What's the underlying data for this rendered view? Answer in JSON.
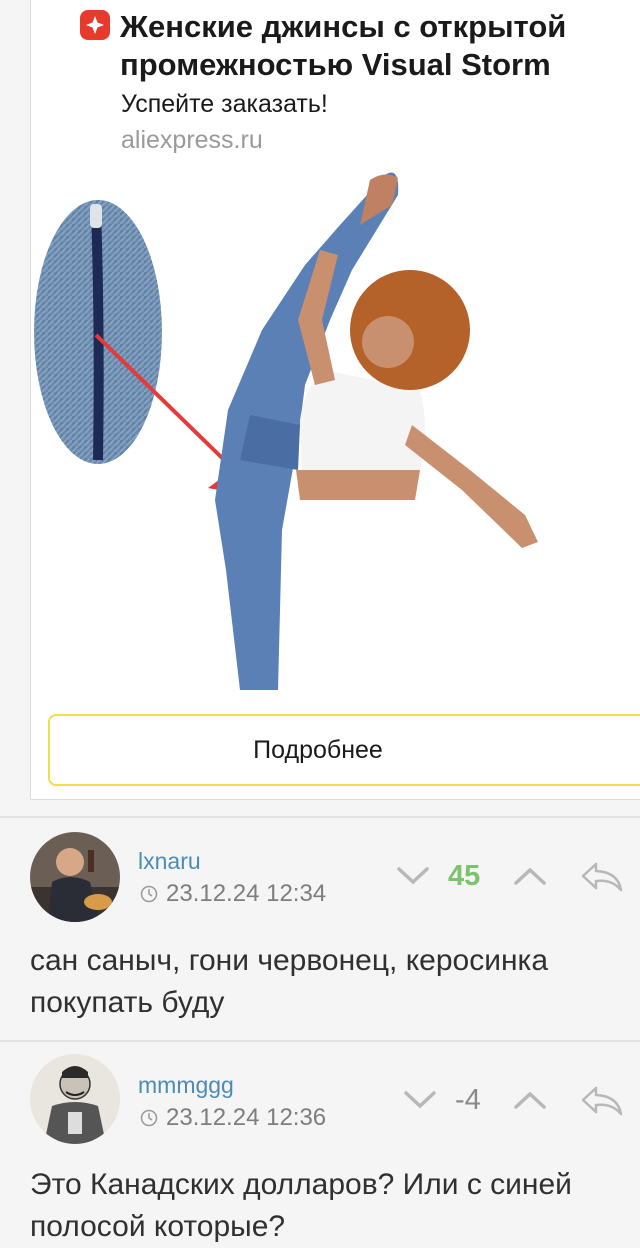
{
  "ad": {
    "title": "Женские джинсы с открытой промежностью Visual Storm",
    "subtitle": "Успейте заказать!",
    "domain": "aliexpress.ru",
    "button_label": "Подробнее",
    "accent_color": "#f1dd4a",
    "logo_color": "#e8392d"
  },
  "comments": [
    {
      "username": "lxnaru",
      "time": "23.12.24 12:34",
      "rating": "45",
      "rating_color": "#7dc36b",
      "text": "сан саныч, гони червонец, керосинка покупать буду"
    },
    {
      "username": "mmmggg",
      "time": "23.12.24 12:36",
      "rating": "-4",
      "rating_color": "#8a8a8a",
      "text": "Это Канадских долларов? Или с синей полосой которые?"
    }
  ]
}
